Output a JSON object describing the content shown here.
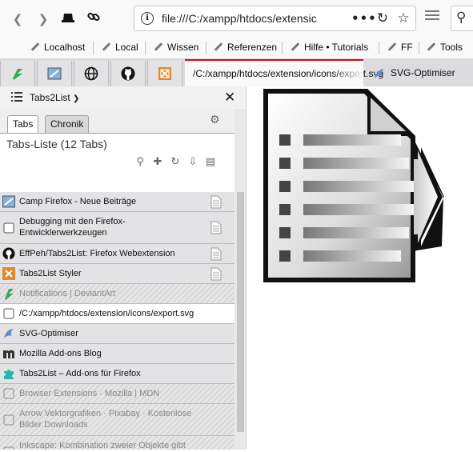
{
  "navbar": {
    "url": "file:///C:/xampp/htdocs/extensic",
    "icons": [
      "back-icon",
      "forward-icon",
      "hat-icon",
      "link-icon",
      "info-icon",
      "more-icon",
      "reload-icon",
      "star-icon",
      "library-icon",
      "search-icon"
    ]
  },
  "bookmarks": {
    "items": [
      {
        "label": "Localhost"
      },
      {
        "label": "Local"
      },
      {
        "label": "Wissen"
      },
      {
        "label": "Referenzen"
      },
      {
        "label": "Hilfe • Tutorials"
      },
      {
        "label": "FF"
      },
      {
        "label": "Tools"
      }
    ]
  },
  "tabs": {
    "active_label": "/C:/xampp/htdocs/extension/icons/export.svg",
    "second_label": "SVG-Optimiser"
  },
  "sidebar": {
    "title": "Tabs2List",
    "tab_tabs": "Tabs",
    "tab_history": "Chronik",
    "list_title": "Tabs-Liste (12 Tabs)",
    "rows": [
      {
        "label": "Camp Firefox - Neue Beiträge"
      },
      {
        "label": "Debugging mit den Firefox-Entwicklerwerkzeugen"
      },
      {
        "label": "EffPeh/Tabs2List: Firefox Webextension"
      },
      {
        "label": "Tabs2List Styler"
      },
      {
        "label": "Notifications | DeviantArt"
      },
      {
        "label": "/C:/xampp/htdocs/extension/icons/export.svg"
      },
      {
        "label": "SVG-Optimiser"
      },
      {
        "label": "Mozilla Add-ons Blog"
      },
      {
        "label": "Tabs2List – Add-ons für Firefox"
      },
      {
        "label": "Browser Extensions - Mozilla | MDN"
      },
      {
        "label": "Arrow Vektorgrafiken · Pixabay · Kostenlose Bilder Downloads"
      },
      {
        "label": "Inkscape: Kombination zweier Objekte gibt"
      }
    ]
  },
  "colors": {
    "active_tab_accent": "#d10e0e",
    "sidebar_bg": "#efeff0",
    "row_bg": "#e3e3e5"
  }
}
